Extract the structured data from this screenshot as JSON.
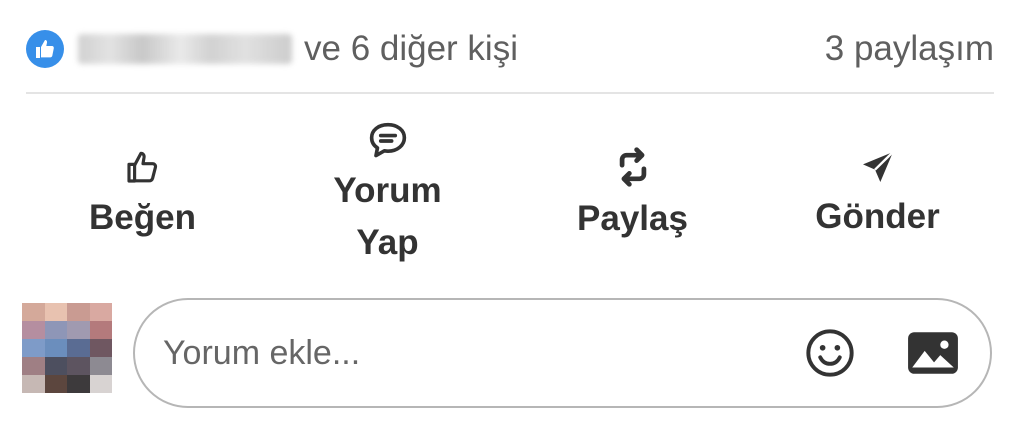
{
  "reactions": {
    "icon": "thumbs-up-icon",
    "others_text": "ve 6 diğer kişi",
    "shares_text": "3 paylaşım"
  },
  "actions": [
    {
      "label": "Beğen",
      "icon": "like-icon"
    },
    {
      "label": "Yorum Yap",
      "icon": "comment-icon"
    },
    {
      "label": "Paylaş",
      "icon": "repost-icon"
    },
    {
      "label": "Gönder",
      "icon": "send-icon"
    }
  ],
  "comment": {
    "placeholder": "Yorum ekle...",
    "emoji_icon": "emoji-icon",
    "image_icon": "image-icon"
  },
  "colors": {
    "like_blue": "#378fe9",
    "text_primary": "#333333",
    "text_secondary": "#5f5f5f",
    "border": "#b6b6b6"
  },
  "avatar_pixels": [
    "#d4a99a",
    "#e8c2b0",
    "#c99b92",
    "#d9a9a1",
    "#b58ea0",
    "#8e96b7",
    "#a09ab0",
    "#b47a7c",
    "#7e9bc8",
    "#6b8ebd",
    "#5a6c93",
    "#6f5761",
    "#9f7f84",
    "#4d4f5f",
    "#5d5460",
    "#8d8a92",
    "#c6b8b4",
    "#5c463e",
    "#3d3a3c",
    "#d8d3d2"
  ]
}
